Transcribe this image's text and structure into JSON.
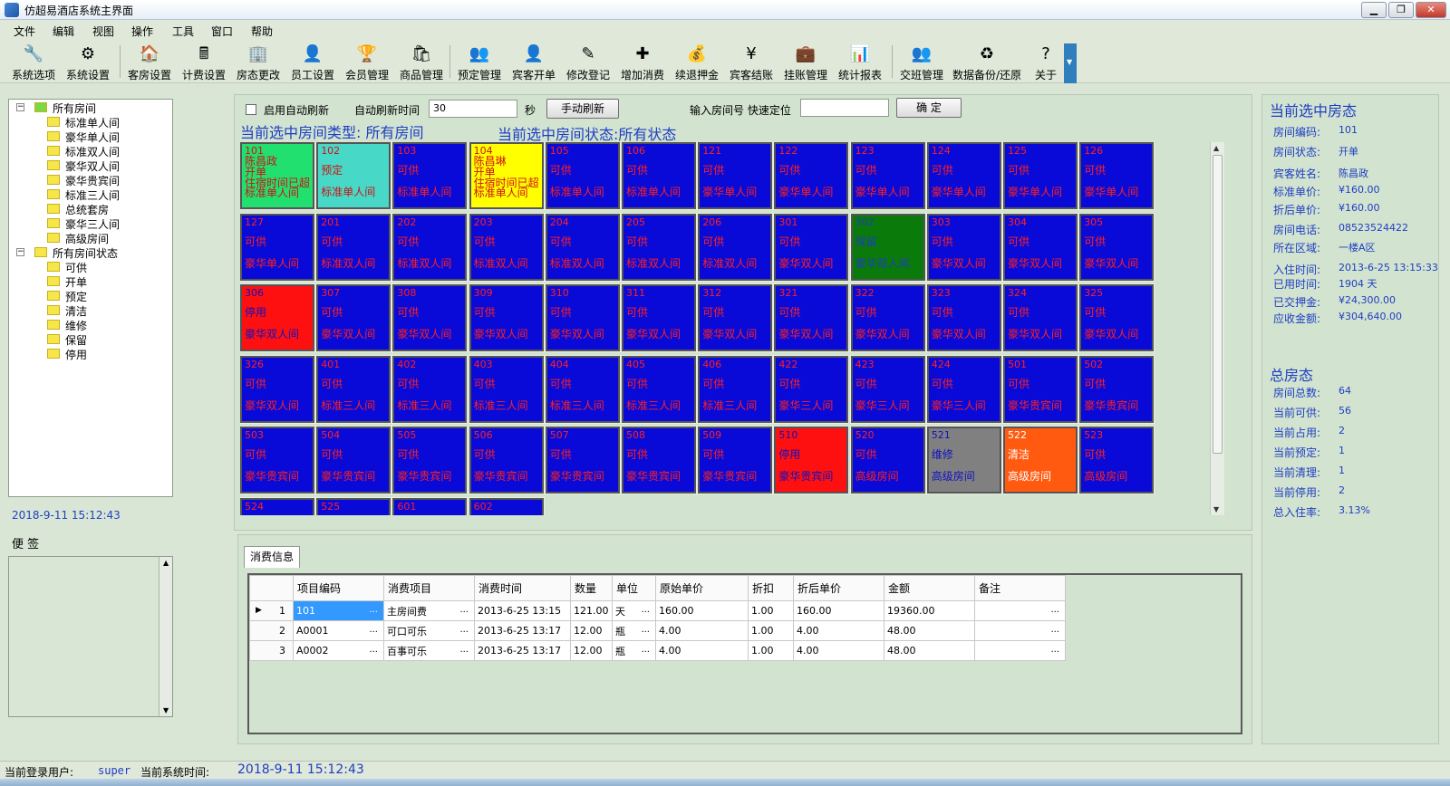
{
  "window": {
    "title": "仿超易酒店系统主界面",
    "min": "▁",
    "max": "❐",
    "close": "✕"
  },
  "menu": [
    "文件",
    "编辑",
    "视图",
    "操作",
    "工具",
    "窗口",
    "帮助"
  ],
  "toolbar": [
    {
      "label": "系统选项",
      "icon": "settings-options-icon",
      "glyph": "🔧"
    },
    {
      "label": "系统设置",
      "icon": "system-settings-icon",
      "glyph": "⚙"
    },
    {
      "label": "客房设置",
      "icon": "room-settings-icon",
      "glyph": "🏠"
    },
    {
      "label": "计费设置",
      "icon": "billing-settings-icon",
      "glyph": "🖩"
    },
    {
      "label": "房态更改",
      "icon": "room-status-change-icon",
      "glyph": "🏢"
    },
    {
      "label": "员工设置",
      "icon": "staff-settings-icon",
      "glyph": "👤"
    },
    {
      "label": "会员管理",
      "icon": "member-icon",
      "glyph": "🏆"
    },
    {
      "label": "商品管理",
      "icon": "goods-icon",
      "glyph": "🛍"
    },
    {
      "label": "预定管理",
      "icon": "reservation-icon",
      "glyph": "👥"
    },
    {
      "label": "宾客开单",
      "icon": "checkin-icon",
      "glyph": "👤"
    },
    {
      "label": "修改登记",
      "icon": "edit-registration-icon",
      "glyph": "✎"
    },
    {
      "label": "增加消费",
      "icon": "add-consumption-icon",
      "glyph": "✚"
    },
    {
      "label": "续退押金",
      "icon": "deposit-icon",
      "glyph": "💰"
    },
    {
      "label": "宾客结账",
      "icon": "checkout-icon",
      "glyph": "¥"
    },
    {
      "label": "挂账管理",
      "icon": "credit-account-icon",
      "glyph": "💼"
    },
    {
      "label": "统计报表",
      "icon": "report-icon",
      "glyph": "📊"
    },
    {
      "label": "交班管理",
      "icon": "shift-icon",
      "glyph": "👥"
    },
    {
      "label": "数据备份/还原",
      "icon": "backup-icon",
      "glyph": "♻"
    },
    {
      "label": "关于",
      "icon": "help-icon",
      "glyph": "?"
    }
  ],
  "tree": {
    "root_types": "所有房间",
    "types": [
      "标准单人间",
      "豪华单人间",
      "标准双人间",
      "豪华双人间",
      "豪华贵宾间",
      "标准三人间",
      "总统套房",
      "豪华三人间",
      "高级房间"
    ],
    "root_status": "所有房间状态",
    "statuses": [
      "可供",
      "开单",
      "预定",
      "清洁",
      "维修",
      "保留",
      "停用"
    ]
  },
  "left": {
    "datetime": "2018-9-11 15:12:43",
    "memo_label": "便  签"
  },
  "controls": {
    "auto_refresh_label": "启用自动刷新",
    "refresh_time_label": "自动刷新时间",
    "refresh_time_value": "30",
    "seconds": "秒",
    "manual_refresh": "手动刷新",
    "room_no_label": "输入房间号  快速定位",
    "confirm": "确  定",
    "room_no_value": ""
  },
  "selected_type": "当前选中房间类型: 所有房间",
  "selected_status": "当前选中房间状态:所有状态",
  "colors": {
    "available": "#0a0ad8",
    "open": "#22e070",
    "reserved": "#48d8c8",
    "overdue": "#ffff00",
    "stopped": "#ff1010",
    "kept": "#0a7a0a",
    "repair": "#808080",
    "cleaning": "#ff5a10"
  },
  "rooms": [
    {
      "no": "101",
      "kind": "open",
      "guest": "陈昌政",
      "state": "开单",
      "warn": "住宿时间已超",
      "type": "标准单人间"
    },
    {
      "no": "102",
      "kind": "reserved",
      "state": "预定",
      "type": "标准单人间"
    },
    {
      "no": "103",
      "kind": "available",
      "state": "可供",
      "type": "标准单人间"
    },
    {
      "no": "104",
      "kind": "overdue",
      "guest": "陈昌琳",
      "state": "开单",
      "warn": "住宿时间已超",
      "type": "标准单人间"
    },
    {
      "no": "105",
      "kind": "available",
      "state": "可供",
      "type": "标准单人间"
    },
    {
      "no": "106",
      "kind": "available",
      "state": "可供",
      "type": "标准单人间"
    },
    {
      "no": "121",
      "kind": "available",
      "state": "可供",
      "type": "豪华单人间"
    },
    {
      "no": "122",
      "kind": "available",
      "state": "可供",
      "type": "豪华单人间"
    },
    {
      "no": "123",
      "kind": "available",
      "state": "可供",
      "type": "豪华单人间"
    },
    {
      "no": "124",
      "kind": "available",
      "state": "可供",
      "type": "豪华单人间"
    },
    {
      "no": "125",
      "kind": "available",
      "state": "可供",
      "type": "豪华单人间"
    },
    {
      "no": "126",
      "kind": "available",
      "state": "可供",
      "type": "豪华单人间"
    },
    {
      "no": "127",
      "kind": "available",
      "state": "可供",
      "type": "豪华单人间"
    },
    {
      "no": "201",
      "kind": "available",
      "state": "可供",
      "type": "标准双人间"
    },
    {
      "no": "202",
      "kind": "available",
      "state": "可供",
      "type": "标准双人间"
    },
    {
      "no": "203",
      "kind": "available",
      "state": "可供",
      "type": "标准双人间"
    },
    {
      "no": "204",
      "kind": "available",
      "state": "可供",
      "type": "标准双人间"
    },
    {
      "no": "205",
      "kind": "available",
      "state": "可供",
      "type": "标准双人间"
    },
    {
      "no": "206",
      "kind": "available",
      "state": "可供",
      "type": "标准双人间"
    },
    {
      "no": "301",
      "kind": "available",
      "state": "可供",
      "type": "豪华双人间"
    },
    {
      "no": "302",
      "kind": "kept",
      "state": "保留",
      "type": "豪华双人间"
    },
    {
      "no": "303",
      "kind": "available",
      "state": "可供",
      "type": "豪华双人间"
    },
    {
      "no": "304",
      "kind": "available",
      "state": "可供",
      "type": "豪华双人间"
    },
    {
      "no": "305",
      "kind": "available",
      "state": "可供",
      "type": "豪华双人间"
    },
    {
      "no": "306",
      "kind": "stopped",
      "state": "停用",
      "type": "豪华双人间"
    },
    {
      "no": "307",
      "kind": "available",
      "state": "可供",
      "type": "豪华双人间"
    },
    {
      "no": "308",
      "kind": "available",
      "state": "可供",
      "type": "豪华双人间"
    },
    {
      "no": "309",
      "kind": "available",
      "state": "可供",
      "type": "豪华双人间"
    },
    {
      "no": "310",
      "kind": "available",
      "state": "可供",
      "type": "豪华双人间"
    },
    {
      "no": "311",
      "kind": "available",
      "state": "可供",
      "type": "豪华双人间"
    },
    {
      "no": "312",
      "kind": "available",
      "state": "可供",
      "type": "豪华双人间"
    },
    {
      "no": "321",
      "kind": "available",
      "state": "可供",
      "type": "豪华双人间"
    },
    {
      "no": "322",
      "kind": "available",
      "state": "可供",
      "type": "豪华双人间"
    },
    {
      "no": "323",
      "kind": "available",
      "state": "可供",
      "type": "豪华双人间"
    },
    {
      "no": "324",
      "kind": "available",
      "state": "可供",
      "type": "豪华双人间"
    },
    {
      "no": "325",
      "kind": "available",
      "state": "可供",
      "type": "豪华双人间"
    },
    {
      "no": "326",
      "kind": "available",
      "state": "可供",
      "type": "豪华双人间"
    },
    {
      "no": "401",
      "kind": "available",
      "state": "可供",
      "type": "标准三人间"
    },
    {
      "no": "402",
      "kind": "available",
      "state": "可供",
      "type": "标准三人间"
    },
    {
      "no": "403",
      "kind": "available",
      "state": "可供",
      "type": "标准三人间"
    },
    {
      "no": "404",
      "kind": "available",
      "state": "可供",
      "type": "标准三人间"
    },
    {
      "no": "405",
      "kind": "available",
      "state": "可供",
      "type": "标准三人间"
    },
    {
      "no": "406",
      "kind": "available",
      "state": "可供",
      "type": "标准三人间"
    },
    {
      "no": "422",
      "kind": "available",
      "state": "可供",
      "type": "豪华三人间"
    },
    {
      "no": "423",
      "kind": "available",
      "state": "可供",
      "type": "豪华三人间"
    },
    {
      "no": "424",
      "kind": "available",
      "state": "可供",
      "type": "豪华三人间"
    },
    {
      "no": "501",
      "kind": "available",
      "state": "可供",
      "type": "豪华贵宾间"
    },
    {
      "no": "502",
      "kind": "available",
      "state": "可供",
      "type": "豪华贵宾间"
    },
    {
      "no": "503",
      "kind": "available",
      "state": "可供",
      "type": "豪华贵宾间"
    },
    {
      "no": "504",
      "kind": "available",
      "state": "可供",
      "type": "豪华贵宾间"
    },
    {
      "no": "505",
      "kind": "available",
      "state": "可供",
      "type": "豪华贵宾间"
    },
    {
      "no": "506",
      "kind": "available",
      "state": "可供",
      "type": "豪华贵宾间"
    },
    {
      "no": "507",
      "kind": "available",
      "state": "可供",
      "type": "豪华贵宾间"
    },
    {
      "no": "508",
      "kind": "available",
      "state": "可供",
      "type": "豪华贵宾间"
    },
    {
      "no": "509",
      "kind": "available",
      "state": "可供",
      "type": "豪华贵宾间"
    },
    {
      "no": "510",
      "kind": "stopped",
      "state": "停用",
      "type": "豪华贵宾间"
    },
    {
      "no": "520",
      "kind": "available",
      "state": "可供",
      "type": "高级房间"
    },
    {
      "no": "521",
      "kind": "repair",
      "state": "维修",
      "type": "高级房间"
    },
    {
      "no": "522",
      "kind": "cleaning",
      "state": "清洁",
      "type": "高级房间"
    },
    {
      "no": "523",
      "kind": "available",
      "state": "可供",
      "type": "高级房间"
    },
    {
      "no": "524",
      "kind": "available",
      "state": "",
      "type": ""
    },
    {
      "no": "525",
      "kind": "available",
      "state": "",
      "type": ""
    },
    {
      "no": "601",
      "kind": "available",
      "state": "",
      "type": ""
    },
    {
      "no": "602",
      "kind": "available",
      "state": "",
      "type": ""
    }
  ],
  "consume": {
    "tab": "消费信息",
    "columns": [
      "项目编码",
      "消费项目",
      "消费时间",
      "数量",
      "单位",
      "原始单价",
      "折扣",
      "折后单价",
      "金额",
      "备注"
    ],
    "rows": [
      {
        "n": "1",
        "code": "101",
        "item": "主房间费",
        "time": "2013-6-25 13:15",
        "qty": "121.00",
        "unit": "天",
        "price": "160.00",
        "disc": "1.00",
        "after": "160.00",
        "amount": "19360.00",
        "note": ""
      },
      {
        "n": "2",
        "code": "A0001",
        "item": "可口可乐",
        "time": "2013-6-25 13:17",
        "qty": "12.00",
        "unit": "瓶",
        "price": "4.00",
        "disc": "1.00",
        "after": "4.00",
        "amount": "48.00",
        "note": ""
      },
      {
        "n": "3",
        "code": "A0002",
        "item": "百事可乐",
        "time": "2013-6-25 13:17",
        "qty": "12.00",
        "unit": "瓶",
        "price": "4.00",
        "disc": "1.00",
        "after": "4.00",
        "amount": "48.00",
        "note": ""
      }
    ]
  },
  "right": {
    "current_title": "当前选中房态",
    "current": [
      {
        "k": "房间编码:",
        "v": "101"
      },
      {
        "k": "房间状态:",
        "v": "开单"
      },
      {
        "k": "宾客姓名:",
        "v": "陈昌政"
      },
      {
        "k": "标准单价:",
        "v": "¥160.00"
      },
      {
        "k": "折后单价:",
        "v": "¥160.00"
      },
      {
        "k": "房间电话:",
        "v": "08523524422"
      },
      {
        "k": "所在区域:",
        "v": "一楼A区"
      },
      {
        "k": "入住时间:",
        "v": "2013-6-25 13:15:33"
      },
      {
        "k": "已用时间:",
        "v": "1904 天"
      },
      {
        "k": "已交押金:",
        "v": "¥24,300.00"
      },
      {
        "k": "应收金额:",
        "v": "¥304,640.00"
      }
    ],
    "total_title": "总房态",
    "total": [
      {
        "k": "房间总数:",
        "v": "64"
      },
      {
        "k": "当前可供:",
        "v": "56"
      },
      {
        "k": "当前占用:",
        "v": "2"
      },
      {
        "k": "当前预定:",
        "v": "1"
      },
      {
        "k": "当前清理:",
        "v": "1"
      },
      {
        "k": "当前停用:",
        "v": "2"
      },
      {
        "k": "总入住率:",
        "v": "3.13%"
      }
    ]
  },
  "status": {
    "user_label": "当前登录用户:",
    "user": "super",
    "time_label": "当前系统时间:",
    "time": "2018-9-11 15:12:43"
  }
}
